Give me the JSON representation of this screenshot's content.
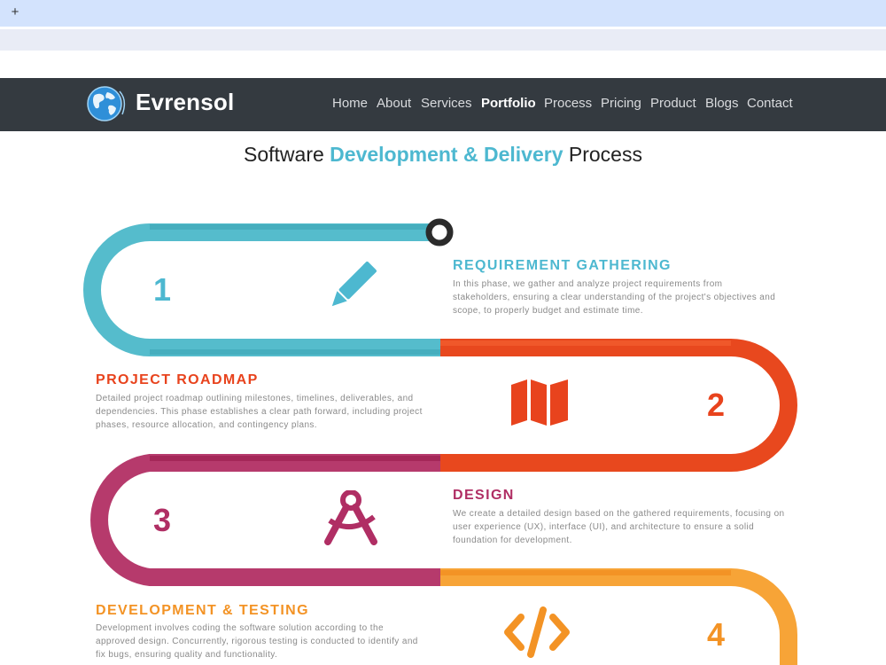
{
  "browser": {
    "new_tab_label": "+"
  },
  "nav": {
    "brand": "Evrensol",
    "items": [
      {
        "label": "Home"
      },
      {
        "label": "About"
      },
      {
        "label": "Services"
      },
      {
        "label": "Portfolio"
      },
      {
        "label": "Process"
      },
      {
        "label": "Pricing"
      },
      {
        "label": "Product"
      },
      {
        "label": "Blogs"
      },
      {
        "label": "Contact"
      }
    ],
    "active": "Portfolio"
  },
  "heading": {
    "pre": "Software ",
    "highlight": "Development & Delivery",
    "post": " Process"
  },
  "colors": {
    "teal": "#4db8d0",
    "red": "#e8431d",
    "purple": "#b02e64",
    "orange": "#f39325",
    "nav_bg": "#343a40"
  },
  "steps": [
    {
      "number": "1",
      "title": "REQUIREMENT GATHERING",
      "icon": "pencil-icon",
      "description": "In this phase, we gather and analyze project requirements from stakeholders, ensuring a clear understanding of the project's objectives and scope, to properly budget and estimate time."
    },
    {
      "number": "2",
      "title": "PROJECT ROADMAP",
      "icon": "map-icon",
      "description": "Detailed project roadmap outlining milestones, timelines, deliverables, and dependencies. This phase establishes a clear path forward, including project phases, resource allocation, and contingency plans."
    },
    {
      "number": "3",
      "title": "DESIGN",
      "icon": "drafting-compass-icon",
      "description": "We create a detailed design based on the gathered requirements, focusing on user experience (UX), interface (UI), and architecture to ensure a solid foundation for development."
    },
    {
      "number": "4",
      "title": "DEVELOPMENT & TESTING",
      "icon": "code-icon",
      "description": "Development involves coding the software solution according to the approved design. Concurrently, rigorous testing is conducted to identify and fix bugs, ensuring quality and functionality."
    }
  ]
}
